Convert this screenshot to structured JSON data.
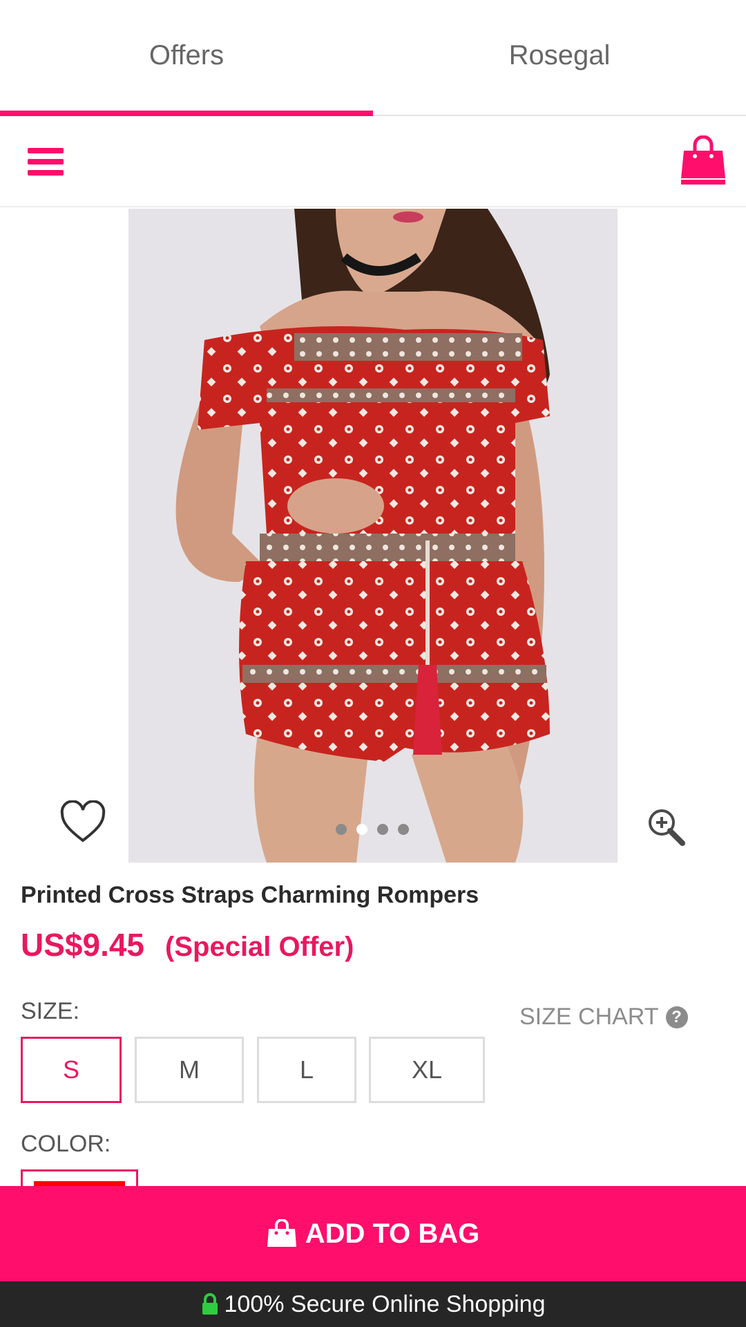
{
  "tabs": [
    {
      "label": "Offers",
      "active": true
    },
    {
      "label": "Rosegal",
      "active": false
    }
  ],
  "appbar": {
    "menu_icon": "hamburger-menu-icon",
    "bag_icon": "shopping-bag-icon"
  },
  "product": {
    "title": "Printed Cross Straps Charming Rompers",
    "price": "US$9.45",
    "offer_label": "(Special Offer)",
    "image_count": 4,
    "active_image": 2
  },
  "size": {
    "label": "SIZE:",
    "chart_label": "SIZE CHART",
    "options": [
      "S",
      "M",
      "L",
      "XL"
    ],
    "selected": "S"
  },
  "color": {
    "label": "COLOR:",
    "selected_swatch": "#ff0000"
  },
  "cta": {
    "add_to_bag": "ADD TO BAG"
  },
  "footer": {
    "secure_text": "100% Secure Online Shopping"
  },
  "colors": {
    "accent": "#ff0e6c",
    "price": "#e8185f",
    "footer_bg": "#262626",
    "lock": "#2ecc40"
  }
}
